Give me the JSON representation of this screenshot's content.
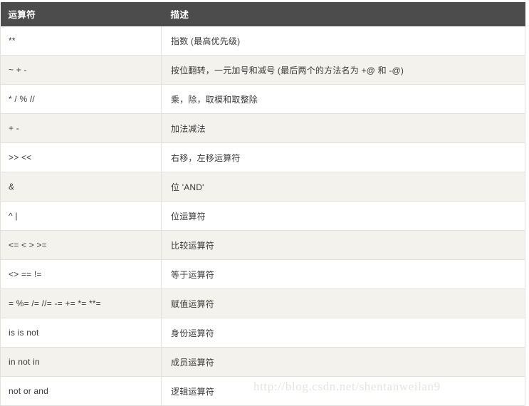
{
  "table": {
    "columns": [
      {
        "key": "operator",
        "label": "运算符"
      },
      {
        "key": "description",
        "label": "描述"
      }
    ],
    "rows": [
      {
        "operator": "**",
        "description": "指数 (最高优先级)"
      },
      {
        "operator": "~ + -",
        "description": "按位翻转，一元加号和减号 (最后两个的方法名为 +@ 和 -@)"
      },
      {
        "operator": "* / % //",
        "description": "乘，除，取模和取整除"
      },
      {
        "operator": "+ -",
        "description": "加法减法"
      },
      {
        "operator": ">> <<",
        "description": "右移，左移运算符"
      },
      {
        "operator": "&",
        "description": "位 'AND'"
      },
      {
        "operator": "^ |",
        "description": "位运算符"
      },
      {
        "operator": "<= < > >=",
        "description": "比较运算符"
      },
      {
        "operator": "<> == !=",
        "description": "等于运算符"
      },
      {
        "operator": "= %= /= //= -= += *= **=",
        "description": "赋值运算符"
      },
      {
        "operator": "is is not",
        "description": "身份运算符"
      },
      {
        "operator": "in not in",
        "description": "成员运算符"
      },
      {
        "operator": "not or and",
        "description": "逻辑运算符"
      }
    ]
  },
  "watermark": {
    "text": "http://blog.csdn.net/shentanweilan9"
  },
  "colors": {
    "header_bg": "#4c4c4c",
    "header_text": "#ffffff",
    "row_odd_bg": "#ffffff",
    "row_even_bg": "#f4f2ed",
    "border": "#e3e1dc",
    "body_text": "#3a3a3a",
    "watermark_text": "#e7e5e2"
  }
}
